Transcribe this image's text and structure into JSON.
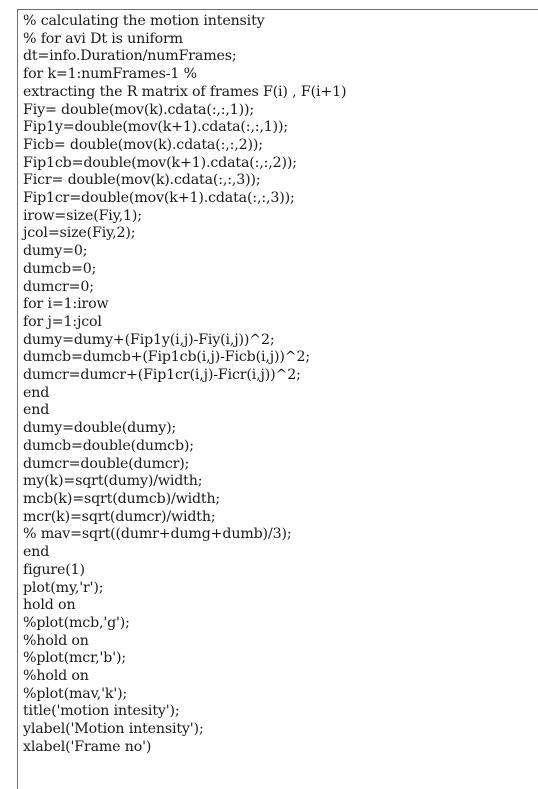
{
  "code": {
    "lines": [
      "% calculating the motion intensity",
      "% for avi Dt is uniform",
      "dt=info.Duration/numFrames;",
      "for k=1:numFrames-1 %",
      "extracting the R matrix of frames F(i) , F(i+1)",
      "Fiy= double(mov(k).cdata(:,:,1));",
      "Fip1y=double(mov(k+1).cdata(:,:,1));",
      "Ficb= double(mov(k).cdata(:,:,2));",
      "Fip1cb=double(mov(k+1).cdata(:,:,2));",
      "Ficr= double(mov(k).cdata(:,:,3));",
      "Fip1cr=double(mov(k+1).cdata(:,:,3));",
      "irow=size(Fiy,1);",
      "jcol=size(Fiy,2);",
      "dumy=0;",
      "dumcb=0;",
      "dumcr=0;",
      "for i=1:irow",
      "for j=1:jcol",
      "dumy=dumy+(Fip1y(i,j)-Fiy(i,j))^2;",
      "dumcb=dumcb+(Fip1cb(i,j)-Ficb(i,j))^2;",
      "dumcr=dumcr+(Fip1cr(i,j)-Ficr(i,j))^2;",
      "end",
      "end",
      "dumy=double(dumy);",
      "dumcb=double(dumcb);",
      "dumcr=double(dumcr);",
      "my(k)=sqrt(dumy)/width;",
      "mcb(k)=sqrt(dumcb)/width;",
      "mcr(k)=sqrt(dumcr)/width;",
      "% mav=sqrt((dumr+dumg+dumb)/3);",
      "end",
      "figure(1)",
      "plot(my,'r');",
      "hold on",
      "%plot(mcb,'g');",
      "%hold on",
      "%plot(mcr,'b');",
      "%hold on",
      "%plot(mav,'k');",
      "title('motion intesity');",
      "ylabel('Motion intensity');",
      "xlabel('Frame no')"
    ]
  }
}
